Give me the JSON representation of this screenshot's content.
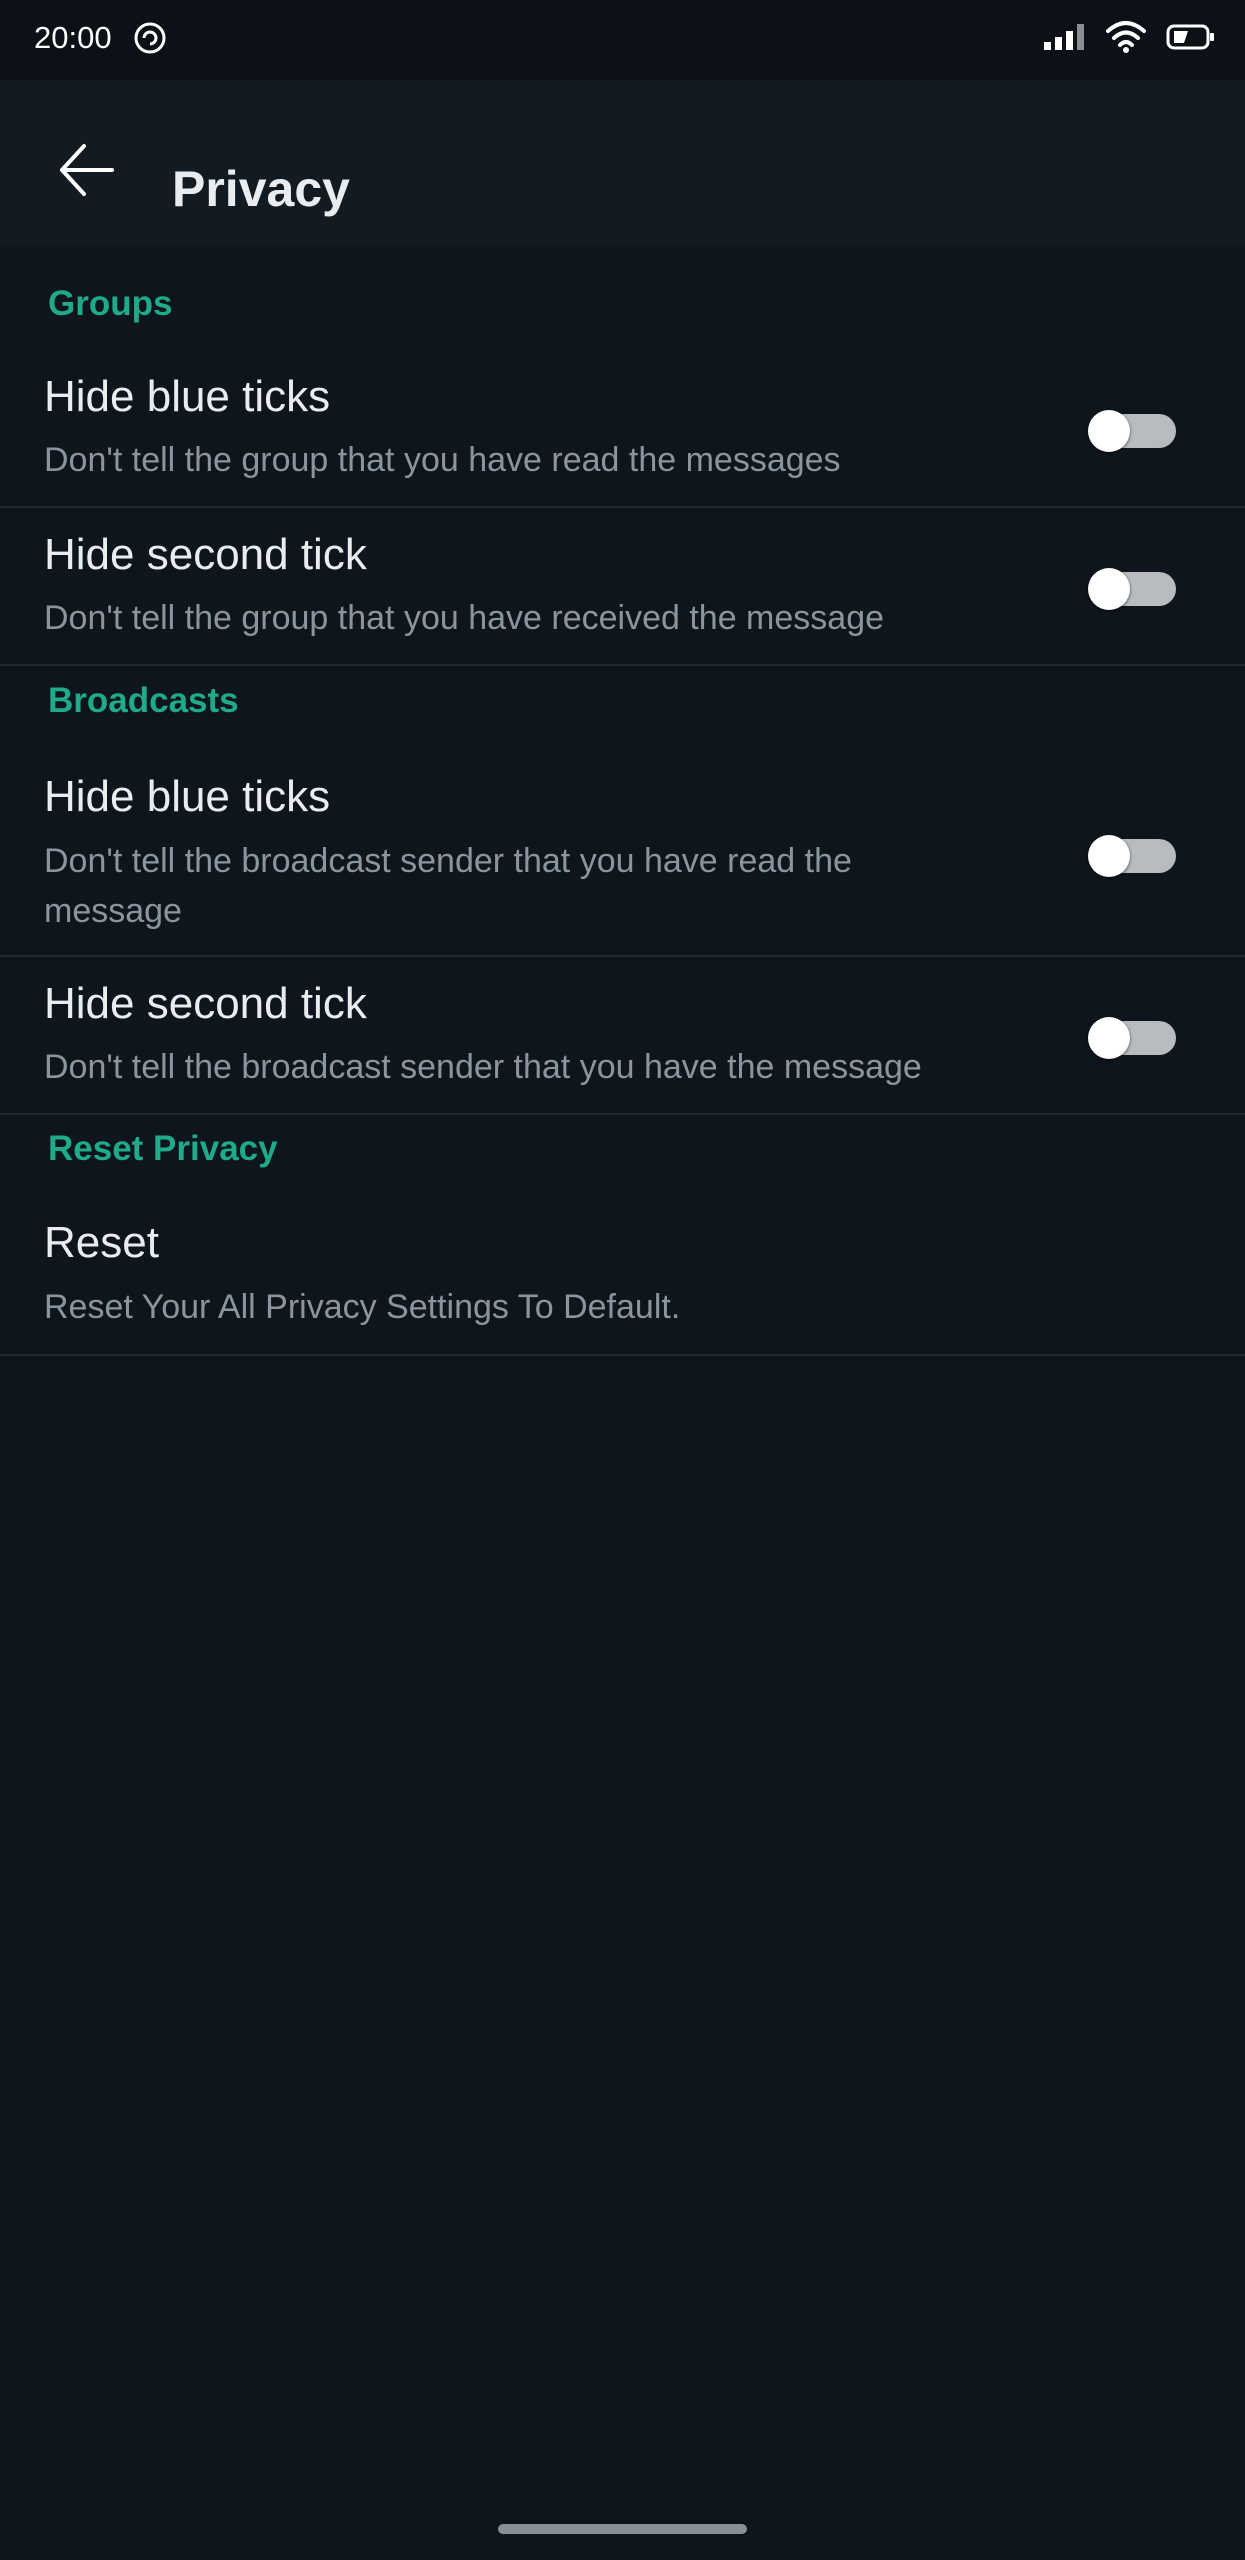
{
  "status_bar": {
    "time": "20:00",
    "icons": [
      "sync-icon",
      "signal-icon",
      "wifi-icon",
      "battery-icon"
    ]
  },
  "app_bar": {
    "back_icon": "arrow-left-icon",
    "title": "Privacy"
  },
  "sections": {
    "groups": {
      "header": "Groups",
      "items": [
        {
          "title": "Hide blue ticks",
          "description": "Don't tell the group that you have read the messages",
          "enabled": false
        },
        {
          "title": "Hide second tick",
          "description": "Don't tell the group that you have received the message",
          "enabled": false
        }
      ]
    },
    "broadcasts": {
      "header": "Broadcasts",
      "items": [
        {
          "title": "Hide blue ticks",
          "description": "Don't tell the broadcast sender that you have read the message",
          "enabled": false
        },
        {
          "title": "Hide second tick",
          "description": "Don't tell the broadcast sender that you have the message",
          "enabled": false
        }
      ]
    },
    "reset_privacy": {
      "header": "Reset Privacy",
      "items": [
        {
          "title": "Reset",
          "description": "Reset Your All Privacy Settings To Default."
        }
      ]
    }
  },
  "colors": {
    "background": "#0e151c",
    "app_bar": "#111b21",
    "accent": "#1faa8a",
    "primary_text": "#e9edef",
    "secondary_text": "#8a969d",
    "toggle_off_track": "#b9bcbe",
    "toggle_thumb": "#ffffff"
  }
}
